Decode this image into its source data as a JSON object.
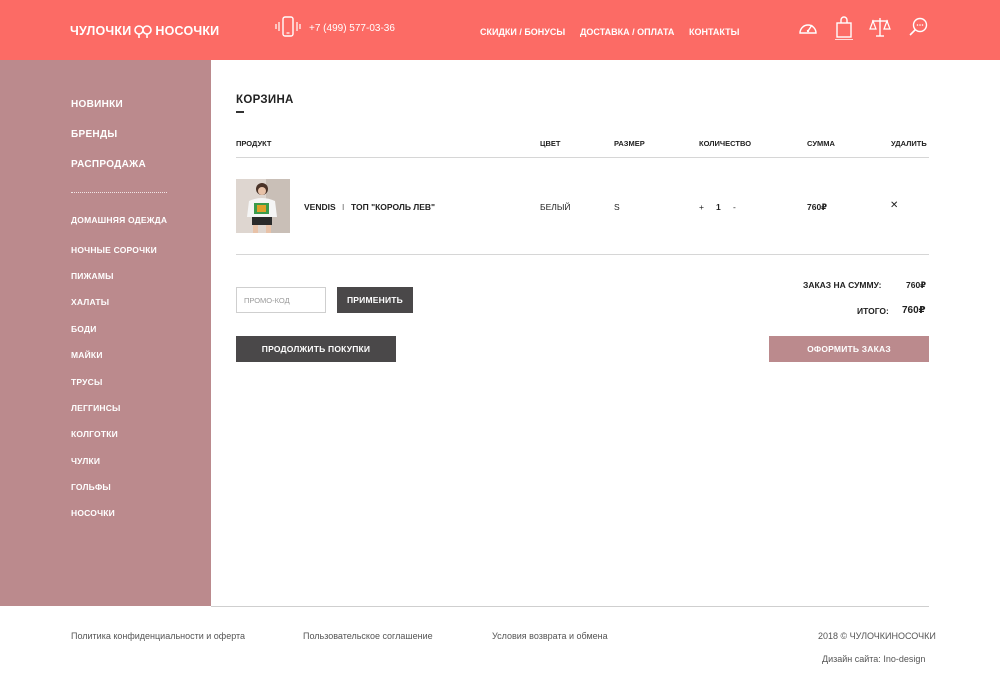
{
  "header": {
    "logo_left": "ЧУЛОЧКИ",
    "logo_right": "НОСОЧКИ",
    "phone": "+7 (499) 577-03-36",
    "nav": [
      {
        "label": "СКИДКИ / БОНУСЫ"
      },
      {
        "label": "ДОСТАВКА / ОПЛАТА"
      },
      {
        "label": "КОНТАКТЫ"
      }
    ],
    "icons": [
      "speedometer-icon",
      "shopping-bag-icon",
      "scales-icon",
      "search-icon"
    ],
    "background_color": "#fc6b65"
  },
  "sidebar": {
    "main_items": [
      {
        "label": "НОВИНКИ"
      },
      {
        "label": "БРЕНДЫ"
      },
      {
        "label": "РАСПРОДАЖА"
      }
    ],
    "sub_items": [
      {
        "label": "ДОМАШНЯЯ ОДЕЖДА"
      },
      {
        "label": "НОЧНЫЕ СОРОЧКИ"
      },
      {
        "label": "ПИЖАМЫ"
      },
      {
        "label": "ХАЛАТЫ"
      },
      {
        "label": "БОДИ"
      },
      {
        "label": "МАЙКИ"
      },
      {
        "label": "ТРУСЫ"
      },
      {
        "label": "ЛЕГГИНСЫ"
      },
      {
        "label": "КОЛГОТКИ"
      },
      {
        "label": "ЧУЛКИ"
      },
      {
        "label": "ГОЛЬФЫ"
      },
      {
        "label": "НОСОЧКИ"
      }
    ],
    "background_color": "#bb8a8d"
  },
  "cart": {
    "title": "КОРЗИНА",
    "columns": {
      "product": "ПРОДУКТ",
      "color": "ЦВЕТ",
      "size": "РАЗМЕР",
      "quantity": "КОЛИЧЕСТВО",
      "sum": "СУММА",
      "delete": "УДАЛИТЬ"
    },
    "items": [
      {
        "brand": "VENDIS",
        "separator": "I",
        "name": "ТОП \"КОРОЛЬ ЛЕВ\"",
        "color": "БЕЛЫЙ",
        "size": "S",
        "plus": "+",
        "quantity": "1",
        "minus": "-",
        "sum": "760₽",
        "remove": "✕"
      }
    ],
    "promo_placeholder": "ПРОМО-КОД",
    "apply_label": "ПРИМЕНИТЬ",
    "order_sum_label": "ЗАКАЗ НА СУММУ:",
    "order_sum_value": "760₽",
    "total_label": "ИТОГО:",
    "total_value": "760₽",
    "continue_label": "ПРОДОЛЖИТЬ ПОКУПКИ",
    "checkout_label": "ОФОРМИТЬ ЗАКАЗ"
  },
  "footer": {
    "links": [
      {
        "label": "Политика конфиденциальности и оферта"
      },
      {
        "label": "Пользовательское соглашение"
      },
      {
        "label": "Условия возврата и обмена"
      }
    ],
    "copyright": "2018 © ЧУЛОЧКИНОСОЧКИ",
    "design": "Дизайн сайта: Ino-design"
  }
}
